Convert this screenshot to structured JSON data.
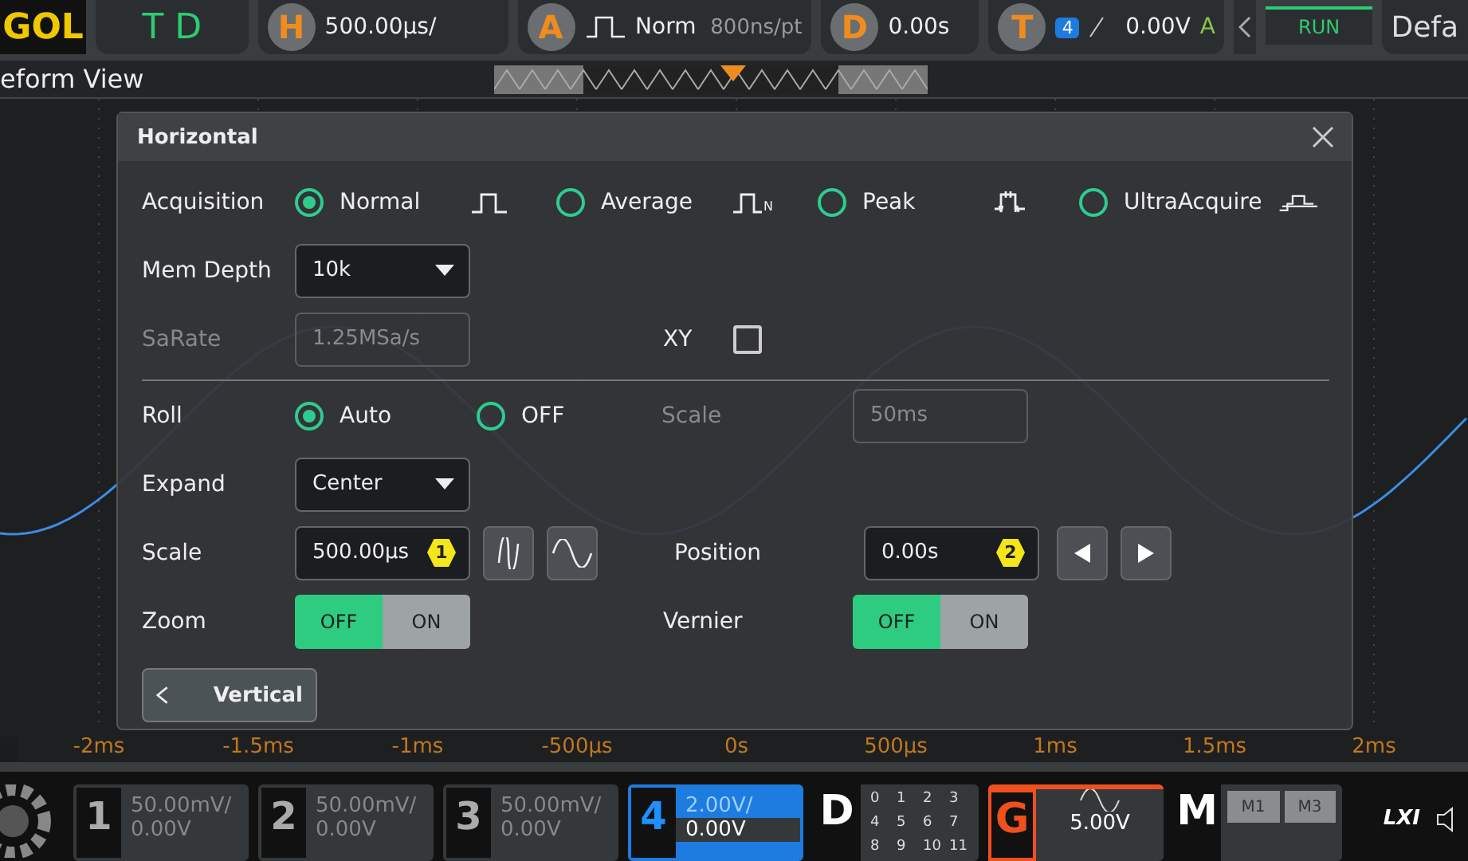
{
  "top_bar": {
    "logo": "GOL",
    "mode": "T D",
    "horizontal": {
      "letter": "H",
      "value": "500.00µs/"
    },
    "acquire": {
      "letter": "A",
      "mode": "Norm",
      "rate": "800ns/pt"
    },
    "delay": {
      "letter": "D",
      "value": "0.00s"
    },
    "trigger": {
      "letter": "T",
      "source": "4",
      "level": "0.00V",
      "coupling": "A"
    },
    "run_status": "RUN",
    "default_button": "Defa"
  },
  "waveform_view": {
    "title": "eform View"
  },
  "dialog": {
    "title": "Horizontal",
    "acquisition": {
      "label": "Acquisition",
      "options": [
        {
          "label": "Normal",
          "selected": true,
          "kind": "normal"
        },
        {
          "label": "Average",
          "selected": false,
          "kind": "average",
          "icon_letter": "N"
        },
        {
          "label": "Peak",
          "selected": false,
          "kind": "peak"
        },
        {
          "label": "UltraAcquire",
          "selected": false,
          "kind": "ultra"
        }
      ]
    },
    "mem_depth": {
      "label": "Mem Depth",
      "value": "10k"
    },
    "sa_rate": {
      "label": "SaRate",
      "value": "1.25MSa/s",
      "disabled": true
    },
    "xy": {
      "label": "XY",
      "checked": false
    },
    "roll": {
      "label": "Roll",
      "options": [
        {
          "label": "Auto",
          "selected": true
        },
        {
          "label": "OFF",
          "selected": false
        }
      ]
    },
    "roll_scale": {
      "label": "Scale",
      "value": "50ms",
      "disabled": true
    },
    "expand": {
      "label": "Expand",
      "value": "Center"
    },
    "scale": {
      "label": "Scale",
      "value": "500.00µs",
      "knob": "1"
    },
    "position": {
      "label": "Position",
      "value": "0.00s",
      "knob": "2"
    },
    "zoom": {
      "label": "Zoom",
      "off_label": "OFF",
      "on_label": "ON",
      "on": false
    },
    "vernier": {
      "label": "Vernier",
      "off_label": "OFF",
      "on_label": "ON",
      "on": false
    },
    "back_button": "Vertical"
  },
  "x_axis": {
    "labels": [
      "-2ms",
      "-1.5ms",
      "-1ms",
      "-500µs",
      "0s",
      "500µs",
      "1ms",
      "1.5ms",
      "2ms"
    ]
  },
  "channels": [
    {
      "number": "1",
      "scale": "50.00mV/",
      "offset": "0.00V",
      "selected": false
    },
    {
      "number": "2",
      "scale": "50.00mV/",
      "offset": "0.00V",
      "selected": false
    },
    {
      "number": "3",
      "scale": "50.00mV/",
      "offset": "0.00V",
      "selected": false
    },
    {
      "number": "4",
      "scale": "2.00V/",
      "offset": "0.00V",
      "selected": true
    }
  ],
  "digital": {
    "letter": "D",
    "bits": [
      "0",
      "1",
      "2",
      "3",
      "4",
      "5",
      "6",
      "7",
      "8",
      "9",
      "10",
      "11"
    ]
  },
  "generator": {
    "letter": "G",
    "amplitude": "5.00V"
  },
  "math": {
    "letter": "M",
    "items": [
      "M1",
      "M3"
    ]
  },
  "lxi": "LXI"
}
